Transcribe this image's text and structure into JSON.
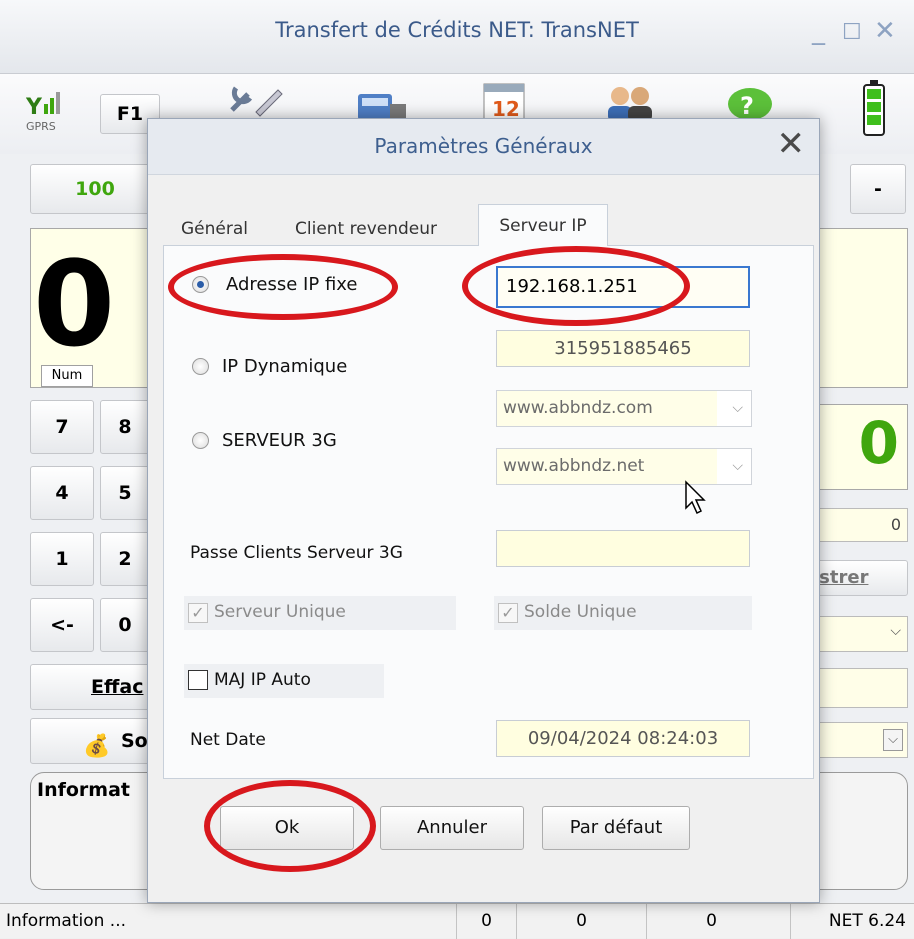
{
  "main": {
    "title": "Transfert de Crédits NET: TransNET",
    "window_controls": {
      "minimize": "_",
      "maximize": "☐",
      "close": "✕"
    },
    "signal_label": "GPRS",
    "f1_label": "F1",
    "amount_button": "100",
    "minus_button": "-",
    "display_value": "0",
    "num_label": "Num",
    "right_display_value": "0",
    "right_small_value": "0",
    "keypad": [
      "7",
      "8",
      "4",
      "5",
      "1",
      "2",
      "<-",
      "0"
    ],
    "effacer_label": "Effac",
    "solde_label": "So",
    "enregistrer_label": "istrer",
    "information_label": "Informat"
  },
  "status_bar": {
    "info": "Information ...",
    "count1": "0",
    "count2": "0",
    "count3": "0",
    "version": "NET 6.24"
  },
  "dialog": {
    "title": "Paramètres Généraux",
    "close_icon": "close-icon",
    "tabs": [
      {
        "label": "Général",
        "active": false
      },
      {
        "label": "Client revendeur",
        "active": false
      },
      {
        "label": "Serveur IP",
        "active": true
      }
    ],
    "radio_fixed_ip_label": "Adresse IP fixe",
    "radio_dynamic_ip_label": "IP Dynamique",
    "radio_3g_label": "SERVEUR 3G",
    "fixed_ip_value": "192.168.1.251",
    "dynamic_ip_value": "315951885465",
    "server_3g_primary": "www.abbndz.com",
    "server_3g_secondary": "www.abbndz.net",
    "pass_label": "Passe Clients Serveur 3G",
    "pass_value": "",
    "serveur_unique_label": "Serveur Unique",
    "solde_unique_label": "Solde Unique",
    "maj_ip_label": "MAJ IP Auto",
    "net_date_label": "Net Date",
    "net_date_value": "09/04/2024 08:24:03",
    "ok_button": "Ok",
    "cancel_button": "Annuler",
    "default_button": "Par défaut"
  },
  "colors": {
    "highlight_ring": "#d8181d",
    "title_text": "#3b5a8a",
    "field_background": "#fffee0",
    "accent_green": "#3fa60e"
  }
}
